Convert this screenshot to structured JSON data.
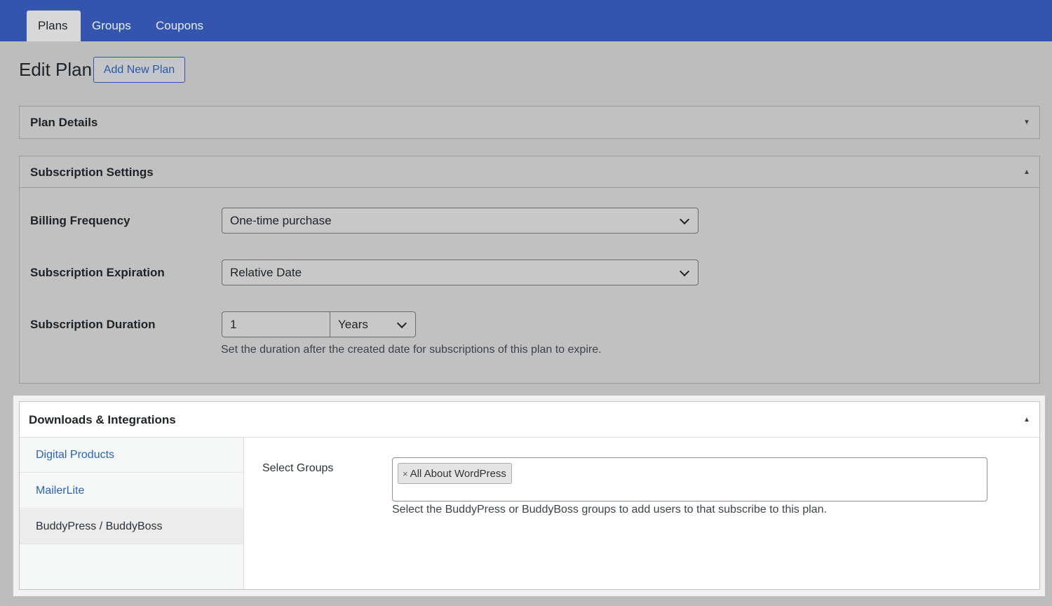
{
  "tabs": [
    {
      "label": "Plans",
      "active": true
    },
    {
      "label": "Groups",
      "active": false
    },
    {
      "label": "Coupons",
      "active": false
    }
  ],
  "page": {
    "title": "Edit Plan",
    "add_new_label": "Add New Plan"
  },
  "plan_details": {
    "title": "Plan Details",
    "toggle_icon": "triangle-down-icon"
  },
  "subscription_settings": {
    "title": "Subscription Settings",
    "toggle_icon": "triangle-up-icon",
    "billing_frequency": {
      "label": "Billing Frequency",
      "value": "One-time purchase"
    },
    "subscription_expiration": {
      "label": "Subscription Expiration",
      "value": "Relative Date"
    },
    "subscription_duration": {
      "label": "Subscription Duration",
      "amount": "1",
      "unit": "Years",
      "help": "Set the duration after the created date for subscriptions of this plan to expire."
    }
  },
  "downloads_integrations": {
    "title": "Downloads & Integrations",
    "toggle_icon": "triangle-up-icon",
    "nav": [
      {
        "label": "Digital Products",
        "active": false
      },
      {
        "label": "MailerLite",
        "active": false
      },
      {
        "label": "BuddyPress / BuddyBoss",
        "active": true
      }
    ],
    "select_groups": {
      "label": "Select Groups",
      "selected": [
        "All About WordPress"
      ],
      "remove_glyph": "×",
      "help": "Select the BuddyPress or BuddyBoss groups to add users to that subscribe to this plan."
    }
  },
  "colors": {
    "header_bar": "#3355ad",
    "link": "#2b63b3",
    "page_overlay": "#bdbdbd"
  }
}
